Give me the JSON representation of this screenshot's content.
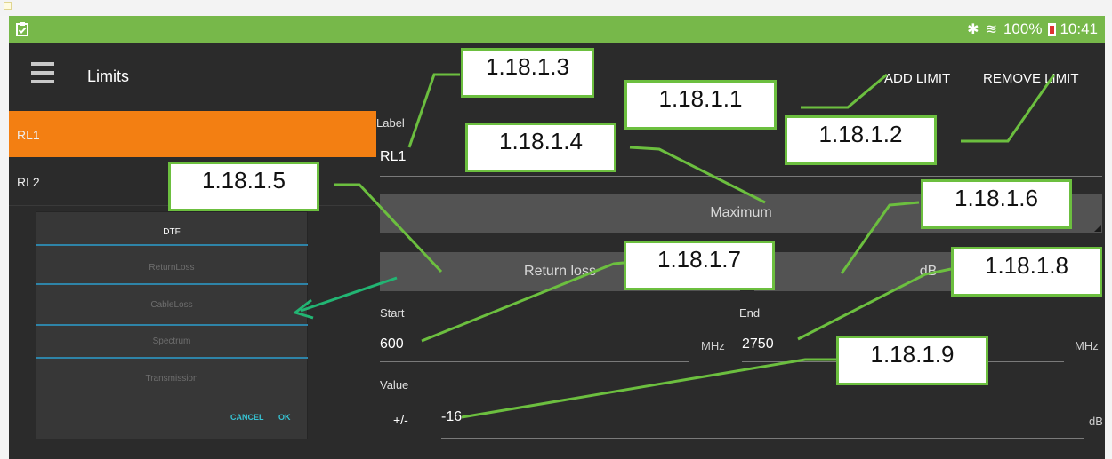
{
  "status": {
    "battery": "100%",
    "time": "10:41"
  },
  "appbar": {
    "title": "Limits",
    "add_label": "ADD LIMIT",
    "remove_label": "REMOVE LIMIT"
  },
  "limits_list": [
    {
      "label": "RL1",
      "selected": true
    },
    {
      "label": "RL2",
      "selected": false
    }
  ],
  "popup": {
    "options": [
      "DTF",
      "ReturnLoss",
      "CableLoss",
      "Spectrum",
      "Transmission"
    ],
    "selected": "DTF",
    "cancel_label": "CANCEL",
    "ok_label": "OK"
  },
  "form": {
    "label_caption": "Label",
    "label_value": "RL1",
    "type_spinner": "Maximum",
    "measure_spinner": "Return loss",
    "unit_spinner": "dB",
    "start_caption": "Start",
    "start_value": "600",
    "start_unit": "MHz",
    "end_caption": "End",
    "end_value": "2750",
    "end_unit": "MHz",
    "value_caption": "Value",
    "value_prefix": "+/-",
    "value_value": "-16",
    "value_unit": "dB"
  },
  "annotations": [
    "1.18.1.3",
    "1.18.1.1",
    "1.18.1.4",
    "1.18.1.2",
    "1.18.1.5",
    "1.18.1.6",
    "1.18.1.7",
    "1.18.1.8",
    "1.18.1.9"
  ],
  "colors": {
    "status_bar": "#77b84a",
    "selected_item": "#f37f12",
    "callout_border": "#6cbf3f",
    "dialog_accent": "#37c4d4"
  }
}
